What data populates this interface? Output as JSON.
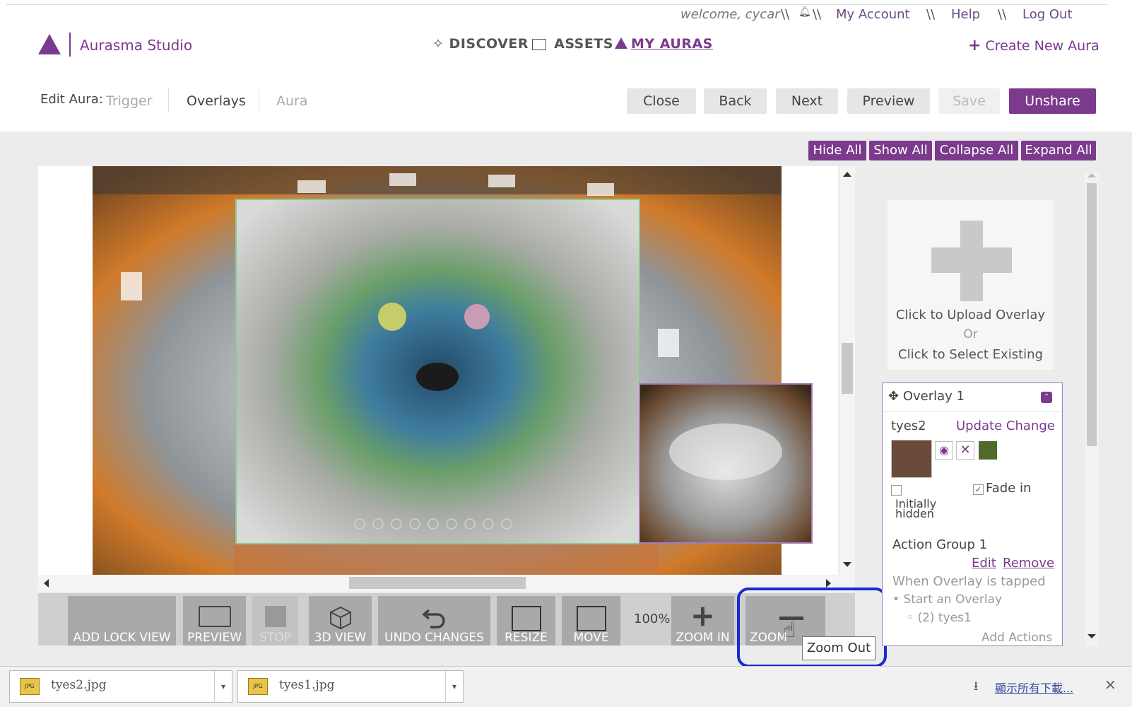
{
  "userbar": {
    "welcome": "welcome, cycar",
    "sep": "\\\\",
    "my_account": "My Account",
    "help": "Help",
    "logout": "Log Out"
  },
  "header": {
    "brand": "Aurasma Studio",
    "nav": [
      "DISCOVER",
      "ASSETS",
      "MY AURAS"
    ],
    "create_new": "Create New Aura"
  },
  "editbar": {
    "label": "Edit Aura:",
    "steps": [
      "Trigger",
      "Overlays",
      "Aura"
    ],
    "buttons": [
      "Close",
      "Back",
      "Next",
      "Preview",
      "Save",
      "Unshare"
    ]
  },
  "panel_buttons": [
    "Hide All",
    "Show All",
    "Collapse All",
    "Expand All"
  ],
  "toolbar": {
    "tools": [
      "ADD LOCK VIEW",
      "PREVIEW",
      "STOP",
      "3D VIEW",
      "UNDO CHANGES",
      "RESIZE",
      "MOVE",
      "ZOOM IN",
      "ZOOM OUT"
    ],
    "zoom_level": "100%",
    "zoom_out_visible": "ZOOM",
    "tooltip": "Zoom Out"
  },
  "upload": {
    "line1": "Click to Upload Overlay",
    "line2": "Or",
    "line3": "Click to Select Existing"
  },
  "overlay_card": {
    "title": "Overlay 1",
    "asset_name": "tyes2",
    "update_link": "Update Change",
    "color_swatch": "#4f6b2a",
    "initially_hidden_line1": "Initially",
    "initially_hidden_line2": "hidden",
    "fade_in": "Fade in",
    "action_group": "Action Group 1",
    "edit": "Edit",
    "remove": "Remove",
    "when_tapped": "When Overlay is tapped",
    "start_overlay": "Start an Overlay",
    "target_overlay": "(2) tyes1",
    "add_actions": "Add Actions"
  },
  "downloads": {
    "files": [
      "tyes2.jpg",
      "tyes1.jpg"
    ],
    "show_all": "顯示所有下載...",
    "close": "×"
  },
  "colors": {
    "brand": "#7b3a8c",
    "highlight": "#1a2bd4"
  }
}
